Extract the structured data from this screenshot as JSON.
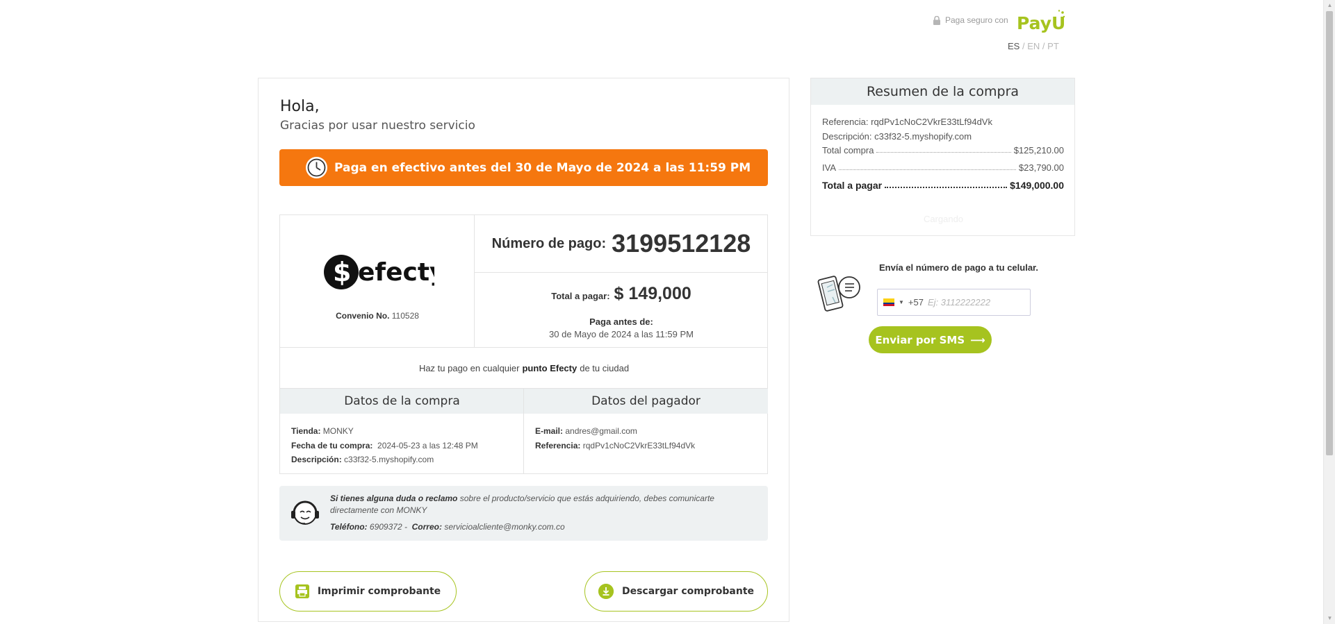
{
  "header": {
    "secure_text": "Paga seguro con",
    "brand": "PayU",
    "langs": [
      "ES",
      "EN",
      "PT"
    ],
    "lang_sep": "/"
  },
  "main": {
    "greeting": "Hola,",
    "thanks": "Gracias por usar nuestro servicio",
    "banner_text": "Paga en efectivo antes del 30 de Mayo de 2024 a las 11:59 PM",
    "efecty_brand": "efecty",
    "convenio_label": "Convenio No.",
    "convenio_value": "110528",
    "numero_pago_label": "Número de pago:",
    "numero_pago_value": "3199512128",
    "total_label": "Total a pagar:",
    "total_value": "$ 149,000",
    "paga_antes_label": "Paga antes de:",
    "paga_antes_value": "30 de Mayo de 2024 a las 11:59 PM",
    "haz_pago_prefix": "Haz tu pago en cualquier",
    "haz_pago_bold": "punto Efecty",
    "haz_pago_suffix": "de tu ciudad",
    "datos_compra": {
      "title": "Datos de la compra",
      "tienda_label": "Tienda:",
      "tienda_value": "MONKY",
      "fecha_label": "Fecha de tu compra:",
      "fecha_value": "2024-05-23 a las 12:48 PM",
      "descripcion_label": "Descripción:",
      "descripcion_value": "c33f32-5.myshopify.com"
    },
    "datos_pagador": {
      "title": "Datos del pagador",
      "email_label": "E-mail:",
      "email_value": "andres@gmail.com",
      "referencia_label": "Referencia:",
      "referencia_value": "rqdPv1cNoC2VkrE33tLf94dVk"
    },
    "support": {
      "bold_intro": "Si tienes alguna duda o reclamo",
      "text": "sobre el producto/servicio que estás adquiriendo, debes comunicarte directamente con MONKY",
      "telefono_label": "Teléfono:",
      "telefono_value": "6909372 -",
      "correo_label": "Correo:",
      "correo_value": "servicioalcliente@monky.com.co"
    },
    "print_button": "Imprimir comprobante",
    "download_button": "Descargar comprobante"
  },
  "summary": {
    "title": "Resumen de la compra",
    "referencia_label": "Referencia:",
    "referencia_value": "rqdPv1cNoC2VkrE33tLf94dVk",
    "descripcion_label": "Descripción:",
    "descripcion_value": "c33f32-5.myshopify.com",
    "total_compra_label": "Total compra",
    "total_compra_value": "$125,210.00",
    "iva_label": "IVA",
    "iva_value": "$23,790.00",
    "total_pagar_label": "Total a pagar",
    "total_pagar_value": "$149,000.00",
    "loading_text": "Cargando"
  },
  "sms": {
    "title": "Envía el número de pago a tu celular.",
    "country_code": "+57",
    "placeholder": "Ej: 3112222222",
    "button": "Enviar por SMS",
    "button_arrow": "⟶"
  },
  "colors": {
    "accent_green": "#a6c31f",
    "banner_orange": "#f5770f",
    "section_gray": "#edf1f2"
  }
}
